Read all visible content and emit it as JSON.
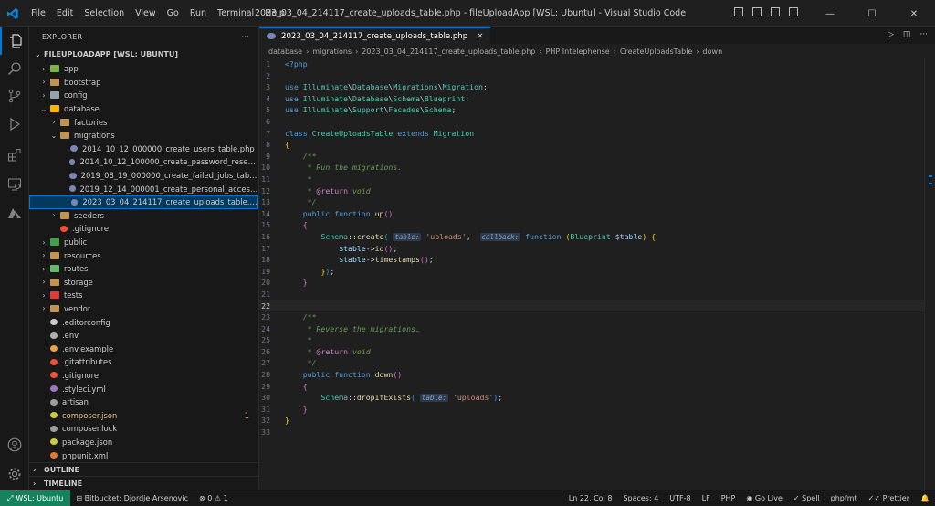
{
  "titlebar": {
    "menus": [
      "File",
      "Edit",
      "Selection",
      "View",
      "Go",
      "Run",
      "Terminal",
      "Help"
    ],
    "window_title": "2023_03_04_214117_create_uploads_table.php - fileUploadApp [WSL: Ubuntu] - Visual Studio Code"
  },
  "sidebar": {
    "header": "EXPLORER",
    "root": "FILEUPLOADAPP [WSL: UBUNTU]",
    "tree": [
      {
        "label": "app",
        "indent": 1,
        "type": "folder",
        "open": false,
        "icon": "folder-app"
      },
      {
        "label": "bootstrap",
        "indent": 1,
        "type": "folder",
        "open": false,
        "icon": "folder"
      },
      {
        "label": "config",
        "indent": 1,
        "type": "folder",
        "open": false,
        "icon": "folder-config"
      },
      {
        "label": "database",
        "indent": 1,
        "type": "folder",
        "open": true,
        "icon": "folder-database"
      },
      {
        "label": "factories",
        "indent": 2,
        "type": "folder",
        "open": false,
        "icon": "folder"
      },
      {
        "label": "migrations",
        "indent": 2,
        "type": "folder",
        "open": true,
        "icon": "folder"
      },
      {
        "label": "2014_10_12_000000_create_users_table.php",
        "indent": 3,
        "type": "file",
        "icon": "php-file"
      },
      {
        "label": "2014_10_12_100000_create_password_resets_table....",
        "indent": 3,
        "type": "file",
        "icon": "php-file"
      },
      {
        "label": "2019_08_19_000000_create_failed_jobs_table.php",
        "indent": 3,
        "type": "file",
        "icon": "php-file"
      },
      {
        "label": "2019_12_14_000001_create_personal_access_token...",
        "indent": 3,
        "type": "file",
        "icon": "php-file"
      },
      {
        "label": "2023_03_04_214117_create_uploads_table.php",
        "indent": 3,
        "type": "file",
        "icon": "php-file",
        "selected": true
      },
      {
        "label": "seeders",
        "indent": 2,
        "type": "folder",
        "open": false,
        "icon": "folder"
      },
      {
        "label": ".gitignore",
        "indent": 2,
        "type": "file",
        "icon": "git-file"
      },
      {
        "label": "public",
        "indent": 1,
        "type": "folder",
        "open": false,
        "icon": "folder-public"
      },
      {
        "label": "resources",
        "indent": 1,
        "type": "folder",
        "open": false,
        "icon": "folder"
      },
      {
        "label": "routes",
        "indent": 1,
        "type": "folder",
        "open": false,
        "icon": "folder-routes"
      },
      {
        "label": "storage",
        "indent": 1,
        "type": "folder",
        "open": false,
        "icon": "folder"
      },
      {
        "label": "tests",
        "indent": 1,
        "type": "folder",
        "open": false,
        "icon": "folder-tests"
      },
      {
        "label": "vendor",
        "indent": 1,
        "type": "folder",
        "open": false,
        "icon": "folder"
      },
      {
        "label": ".editorconfig",
        "indent": 1,
        "type": "file",
        "icon": "config-file"
      },
      {
        "label": ".env",
        "indent": 1,
        "type": "file",
        "icon": "gear-file"
      },
      {
        "label": ".env.example",
        "indent": 1,
        "type": "file",
        "icon": "env-file"
      },
      {
        "label": ".gitattributes",
        "indent": 1,
        "type": "file",
        "icon": "git-file"
      },
      {
        "label": ".gitignore",
        "indent": 1,
        "type": "file",
        "icon": "git-file"
      },
      {
        "label": ".styleci.yml",
        "indent": 1,
        "type": "file",
        "icon": "yml-file"
      },
      {
        "label": "artisan",
        "indent": 1,
        "type": "file",
        "icon": "text-file"
      },
      {
        "label": "composer.json",
        "indent": 1,
        "type": "file",
        "icon": "json-file",
        "modified": true,
        "badge": "1"
      },
      {
        "label": "composer.lock",
        "indent": 1,
        "type": "file",
        "icon": "lock-file"
      },
      {
        "label": "package.json",
        "indent": 1,
        "type": "file",
        "icon": "json-file"
      },
      {
        "label": "phpunit.xml",
        "indent": 1,
        "type": "file",
        "icon": "xml-file"
      }
    ],
    "outline": "OUTLINE",
    "timeline": "TIMELINE"
  },
  "editor": {
    "tab_label": "2023_03_04_214117_create_uploads_table.php",
    "breadcrumb": [
      "database",
      "migrations",
      "2023_03_04_214117_create_uploads_table.php",
      "PHP Intelephense",
      "CreateUploadsTable",
      "down"
    ],
    "current_line": 22,
    "lines": [
      {
        "n": 1,
        "html": "<span class='php'>&lt;?php</span>"
      },
      {
        "n": 2,
        "html": ""
      },
      {
        "n": 3,
        "html": "<span class='k'>use</span> <span class='ns'>Illuminate</span>\\<span class='ns'>Database</span>\\<span class='ns'>Migrations</span>\\<span class='cls'>Migration</span>;"
      },
      {
        "n": 4,
        "html": "<span class='k'>use</span> <span class='ns'>Illuminate</span>\\<span class='ns'>Database</span>\\<span class='ns'>Schema</span>\\<span class='cls'>Blueprint</span>;"
      },
      {
        "n": 5,
        "html": "<span class='k'>use</span> <span class='ns'>Illuminate</span>\\<span class='ns'>Support</span>\\<span class='ns'>Facades</span>\\<span class='cls'>Schema</span>;"
      },
      {
        "n": 6,
        "html": ""
      },
      {
        "n": 7,
        "html": "<span class='k'>class</span> <span class='cls'>CreateUploadsTable</span> <span class='k'>extends</span> <span class='cls'>Migration</span>"
      },
      {
        "n": 8,
        "html": "<span class='brk1'>{</span>"
      },
      {
        "n": 9,
        "html": "    <span class='cm'>/**</span>"
      },
      {
        "n": 10,
        "html": "    <span class='cm'> * Run the migrations.</span>"
      },
      {
        "n": 11,
        "html": "    <span class='cm'> *</span>"
      },
      {
        "n": 12,
        "html": "    <span class='cm'> * </span><span class='kw'>@return</span> <span class='cm'>void</span>"
      },
      {
        "n": 13,
        "html": "    <span class='cm'> */</span>"
      },
      {
        "n": 14,
        "html": "    <span class='k'>public</span> <span class='k'>function</span> <span class='fn'>up</span><span class='brk2'>()</span>"
      },
      {
        "n": 15,
        "html": "    <span class='brk2'>{</span>"
      },
      {
        "n": 16,
        "html": "        <span class='cls'>Schema</span>::<span class='fn'>create</span><span class='brk3'>(</span> <span class='hint'>table:</span> <span class='str'>'uploads'</span>,  <span class='hint'>callback:</span> <span class='k'>function</span> <span class='brk1'>(</span><span class='cls'>Blueprint</span> <span class='var'>$table</span><span class='brk1'>)</span> <span class='brk1'>{</span>"
      },
      {
        "n": 17,
        "html": "            <span class='var'>$table</span>-&gt;<span class='fn'>id</span><span class='brk2'>()</span>;"
      },
      {
        "n": 18,
        "html": "            <span class='var'>$table</span>-&gt;<span class='fn'>timestamps</span><span class='brk2'>()</span>;"
      },
      {
        "n": 19,
        "html": "        <span class='brk1'>}</span><span class='brk3'>)</span>;"
      },
      {
        "n": 20,
        "html": "    <span class='brk2'>}</span>"
      },
      {
        "n": 21,
        "html": ""
      },
      {
        "n": 22,
        "html": ""
      },
      {
        "n": 23,
        "html": "    <span class='cm'>/**</span>"
      },
      {
        "n": 24,
        "html": "    <span class='cm'> * Reverse the migrations.</span>"
      },
      {
        "n": 25,
        "html": "    <span class='cm'> *</span>"
      },
      {
        "n": 26,
        "html": "    <span class='cm'> * </span><span class='kw'>@return</span> <span class='cm'>void</span>"
      },
      {
        "n": 27,
        "html": "    <span class='cm'> */</span>"
      },
      {
        "n": 28,
        "html": "    <span class='k'>public</span> <span class='k'>function</span> <span class='fn'>down</span><span class='brk2'>()</span>"
      },
      {
        "n": 29,
        "html": "    <span class='brk2'>{</span>"
      },
      {
        "n": 30,
        "html": "        <span class='cls'>Schema</span>::<span class='fn'>dropIfExists</span><span class='brk3'>(</span> <span class='hint'>table:</span> <span class='str'>'uploads'</span><span class='brk3'>)</span>;"
      },
      {
        "n": 31,
        "html": "    <span class='brk2'>}</span>"
      },
      {
        "n": 32,
        "html": "<span class='brk1'>}</span>"
      },
      {
        "n": 33,
        "html": ""
      }
    ]
  },
  "statusbar": {
    "remote": "WSL: Ubuntu",
    "bitbucket": "Bitbucket: Djordje Arsenovic",
    "errors": "0",
    "warnings": "1",
    "position": "Ln 22, Col 8",
    "spaces": "Spaces: 4",
    "encoding": "UTF-8",
    "eol": "LF",
    "language": "PHP",
    "golive": "Go Live",
    "spell": "Spell",
    "phpfmt": "phpfmt",
    "prettier": "Prettier"
  },
  "colors": {
    "accent": "#0078d4",
    "remote_bg": "#16825d",
    "selection_bg": "#04395e"
  }
}
